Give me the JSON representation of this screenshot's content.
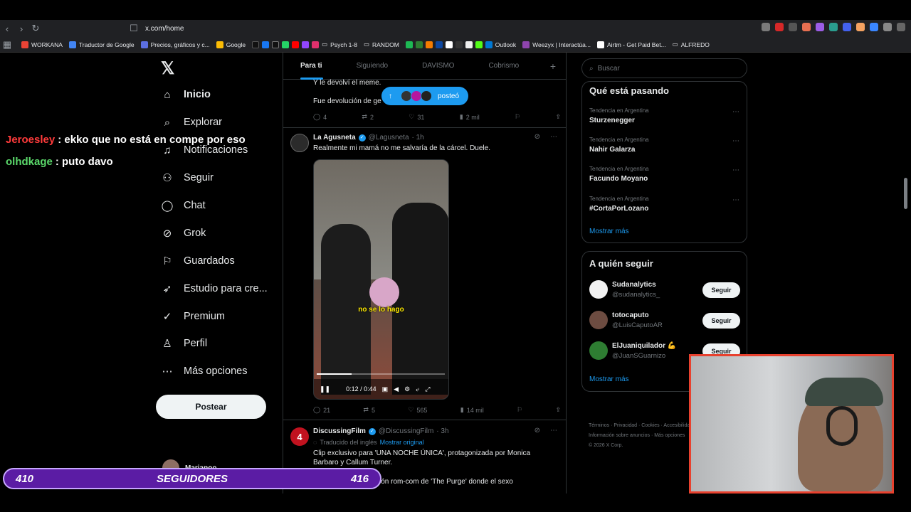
{
  "browser": {
    "url": "x.com/home",
    "bookmarks": [
      "WORKANA",
      "Traductor de Google",
      "Precios, gráficos y c...",
      "Google",
      "Psych 1-8",
      "RANDOM",
      "Outlook",
      "Weezyx | Interactúa...",
      "Airtm - Get Paid Bet...",
      "ALFREDO"
    ]
  },
  "nav": {
    "items": [
      "Inicio",
      "Explorar",
      "Notificaciones",
      "Seguir",
      "Chat",
      "Grok",
      "Guardados",
      "Estudio para cre...",
      "Premium",
      "Perfil",
      "Más opciones"
    ],
    "post_label": "Postear",
    "user_name": "Marianoo"
  },
  "feed": {
    "tabs": [
      "Para ti",
      "Siguiendo",
      "DAVISMO",
      "Cobrismo"
    ],
    "prev_tweet": {
      "line1": "Y le devolví el meme.",
      "line2": "Fue devolución de ge",
      "replies": "4",
      "retweets": "2",
      "likes": "31",
      "views": "2 mil"
    },
    "pill_label": "posteó",
    "tweet1": {
      "name": "La Agusneta",
      "handle": "@Lagusneta",
      "time": "· 1h",
      "text": "Realmente mi mamá no me salvaría de la cárcel. Duele.",
      "subtitle": "no se lo hago",
      "video_time": "0:12 / 0:44",
      "video_progress": 0.27,
      "replies": "21",
      "retweets": "5",
      "likes": "565",
      "views": "14 mil"
    },
    "tweet2": {
      "name": "DiscussingFilm",
      "handle": "@DiscussingFilm",
      "time": "· 3h",
      "translated": "Traducido del inglés",
      "show_original": "Mostrar original",
      "text1": "Clip exclusivo para 'UNA NOCHE ÚNICA', protagonizada por Monica",
      "text2": "Barbaro y Callum Turner.",
      "text3": "sión rom-com de 'The Purge' donde el sexo"
    }
  },
  "right": {
    "search_placeholder": "Buscar",
    "trends_title": "Qué está pasando",
    "trends": [
      {
        "meta": "Tendencia en Argentina",
        "name": "Sturzenegger"
      },
      {
        "meta": "Tendencia en Argentina",
        "name": "Nahir Galarza"
      },
      {
        "meta": "Tendencia en Argentina",
        "name": "Facundo Moyano"
      },
      {
        "meta": "Tendencia en Argentina",
        "name": "#CortaPorLozano"
      }
    ],
    "show_more": "Mostrar más",
    "who_title": "A quién seguir",
    "follows": [
      {
        "name": "Sudanalytics",
        "handle": "@sudanalytics_",
        "btn": "Seguir"
      },
      {
        "name": "totocaputo",
        "handle": "@LuisCaputoAR",
        "btn": "Seguir"
      },
      {
        "name": "ElJuaniquilador 💪",
        "handle": "@JuanSGuarnizo",
        "btn": "Seguir"
      }
    ],
    "footer_line1": "Términos · Privacidad · Cookies · Accesibilidad",
    "footer_line2": "Información sobre anuncios · Más opciones",
    "footer_line3": "© 2026 X Corp."
  },
  "stream": {
    "chat": [
      {
        "user": "Jeroesley",
        "msg": ": ekko que no está en compe por eso",
        "color": "#ff3b3b"
      },
      {
        "user": "olhdkage",
        "msg": ": puto davo",
        "color": "#5bd96b"
      }
    ],
    "followers_left": "410",
    "followers_label": "SEGUIDORES",
    "followers_right": "416"
  }
}
